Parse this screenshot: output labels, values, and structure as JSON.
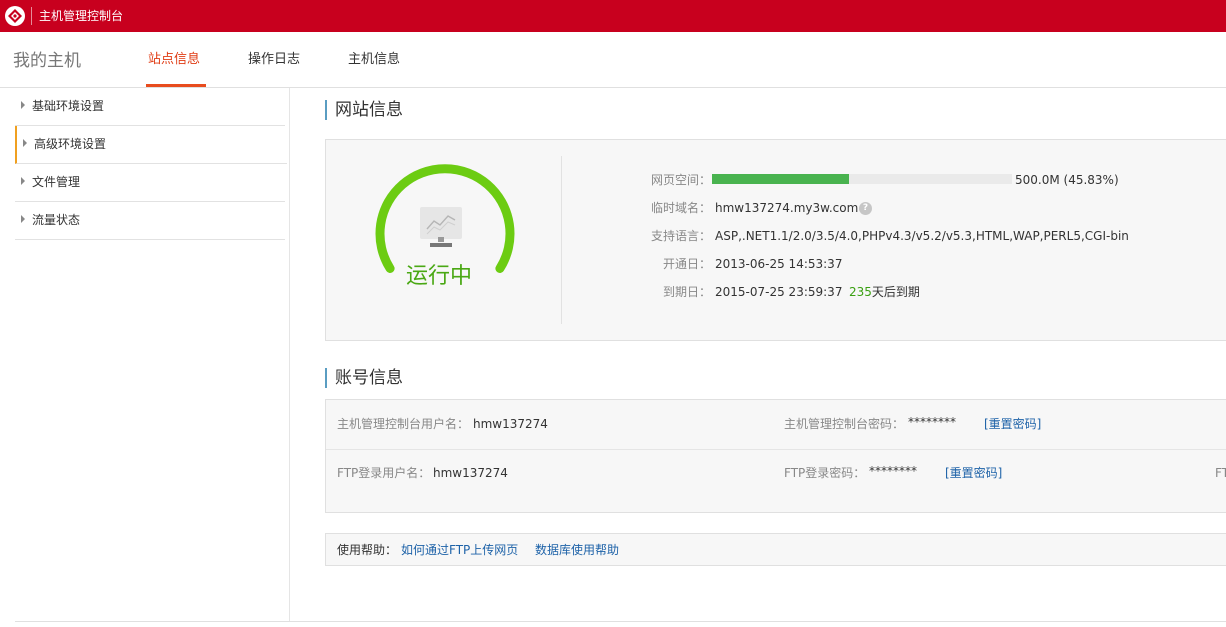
{
  "app": {
    "title": "主机管理控制台",
    "logo_icon": "brand-logo-icon",
    "brand_color": "#c8001e"
  },
  "nav": {
    "heading": "我的主机",
    "tabs": [
      {
        "label": "站点信息",
        "active": true
      },
      {
        "label": "操作日志",
        "active": false
      },
      {
        "label": "主机信息",
        "active": false
      }
    ],
    "active_color": "#e03c14"
  },
  "sidebar": {
    "items": [
      {
        "label": "基础环境设置",
        "active": false
      },
      {
        "label": "高级环境设置",
        "active": true
      },
      {
        "label": "文件管理",
        "active": false
      },
      {
        "label": "流量状态",
        "active": false
      }
    ]
  },
  "site_info": {
    "title": "网站信息",
    "status": "运行中",
    "status_color": "#4aa814",
    "gauge_icon": "monitor-chart-icon",
    "space": {
      "label": "网页空间：",
      "value": "500.0M (45.83%)",
      "percent": 45.83
    },
    "domain": {
      "label": "临时域名：",
      "value": "hmw137274.my3w.com",
      "help": "?"
    },
    "languages": {
      "label": "支持语言：",
      "value": "ASP,.NET1.1/2.0/3.5/4.0,PHPv4.3/v5.2/v5.3,HTML,WAP,PERL5,CGI-bin"
    },
    "open_date": {
      "label": "开通日：",
      "value": "2013-06-25 14:53:37"
    },
    "expire_date": {
      "label": "到期日：",
      "value": "2015-07-25 23:59:37",
      "days": "235",
      "days_suffix": "天后到期"
    }
  },
  "account_info": {
    "title": "账号信息",
    "console_user": {
      "label": "主机管理控制台用户名：",
      "value": "hmw137274"
    },
    "console_password": {
      "label": "主机管理控制台密码：",
      "value": "********",
      "reset": "[重置密码]"
    },
    "ftp_user": {
      "label": "FTP登录用户名：",
      "value": "hmw137274"
    },
    "ftp_password": {
      "label": "FTP登录密码：",
      "value": "********",
      "reset": "[重置密码]"
    },
    "truncated_label": "FT"
  },
  "help": {
    "label": "使用帮助：",
    "links": [
      "如何通过FTP上传网页",
      "数据库使用帮助"
    ]
  }
}
